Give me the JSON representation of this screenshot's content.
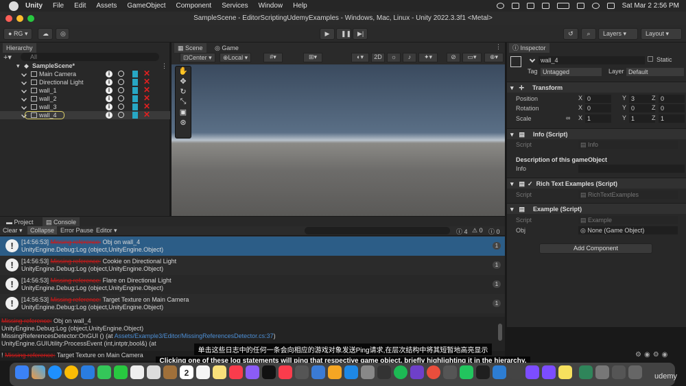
{
  "macos_menubar": {
    "app": "Unity",
    "items": [
      "File",
      "Edit",
      "Assets",
      "GameObject",
      "Component",
      "Services",
      "Window",
      "Help"
    ],
    "clock": "Sat Mar 2  2:56 PM"
  },
  "window_title": "SampleScene - EditorScriptingUdemyExamples - Windows, Mac, Linux - Unity 2022.3.3f1 <Metal>",
  "toolbar": {
    "account": "RG",
    "layers": "Layers",
    "layout": "Layout"
  },
  "hierarchy": {
    "tab": "Hierarchy",
    "search_placeholder": "All",
    "scene": "SampleScene*",
    "items": [
      "Main Camera",
      "Directional Light",
      "wall_1",
      "wall_2",
      "wall_3",
      "wall_4"
    ]
  },
  "scene_view": {
    "tab_scene": "Scene",
    "tab_game": "Game",
    "pivot": "Center",
    "space": "Local",
    "mode_2d": "2D"
  },
  "inspector": {
    "tab": "Inspector",
    "object_name": "wall_4",
    "static_label": "Static",
    "tag_label": "Tag",
    "tag_value": "Untagged",
    "layer_label": "Layer",
    "layer_value": "Default",
    "transform": {
      "title": "Transform",
      "position_label": "Position",
      "rotation_label": "Rotation",
      "scale_label": "Scale",
      "position": [
        "0",
        "3",
        "0"
      ],
      "rotation": [
        "0",
        "0",
        "0"
      ],
      "scale": [
        "1",
        "1",
        "1"
      ]
    },
    "info_script": {
      "title": "Info (Script)",
      "script_label": "Script",
      "script_value": "Info",
      "description_label": "Description of this gameObject",
      "info_label": "Info"
    },
    "rich_text": {
      "title": "Rich Text Examples (Script)",
      "script_label": "Script",
      "script_value": "RichTextExamples"
    },
    "example": {
      "title": "Example (Script)",
      "script_label": "Script",
      "script_value": "Example",
      "obj_label": "Obj",
      "obj_value": "None (Game Object)"
    },
    "add_component": "Add Component"
  },
  "console": {
    "tab_project": "Project",
    "tab_console": "Console",
    "clear": "Clear",
    "collapse": "Collapse",
    "error_pause": "Error Pause",
    "editor": "Editor",
    "count_errors": "4",
    "count_warn": "0",
    "count_log": "0",
    "logs": [
      {
        "time": "[14:56:53]",
        "prefix": "Missing reference:",
        "msg": "Obj on wall_4",
        "line2": "UnityEngine.Debug:Log (object,UnityEngine.Object)",
        "count": "1"
      },
      {
        "time": "[14:56:53]",
        "prefix": "Missing reference:",
        "msg": "Cookie on Directional Light",
        "line2": "UnityEngine.Debug:Log (object,UnityEngine.Object)",
        "count": "1"
      },
      {
        "time": "[14:56:53]",
        "prefix": "Missing reference:",
        "msg": "Flare on Directional Light",
        "line2": "UnityEngine.Debug:Log (object,UnityEngine.Object)",
        "count": "1"
      },
      {
        "time": "[14:56:53]",
        "prefix": "Missing reference:",
        "msg": "Target Texture on Main Camera",
        "line2": "UnityEngine.Debug:Log (object,UnityEngine.Object)",
        "count": "1"
      }
    ],
    "detail": {
      "prefix": "Missing reference:",
      "msg": "Obj on wall_4",
      "l2": "UnityEngine.Debug:Log (object,UnityEngine.Object)",
      "l3a": "MissingReferencesDetector:OnGUI () (at ",
      "l3b": "Assets/Example3/Editor/MissingReferencesDetector.cs:37",
      "l3c": ")",
      "l4": "UnityEngine.GUIUtility:ProcessEvent (int,intptr,bool&) (at"
    },
    "status_prefix": "Missing reference:",
    "status_msg": "Target Texture on Main Camera"
  },
  "subtitles": {
    "zh": "单击这些日志中的任何一条会向相应的游戏对象发送Ping请求,在层次结构中将其短暂地高亮显示",
    "en": "Clicking one of these log statements will ping that respective game object, briefly highlighting it in the hierarchy,"
  },
  "dock": {
    "calendar_day": "2",
    "watermark": "udemy"
  }
}
